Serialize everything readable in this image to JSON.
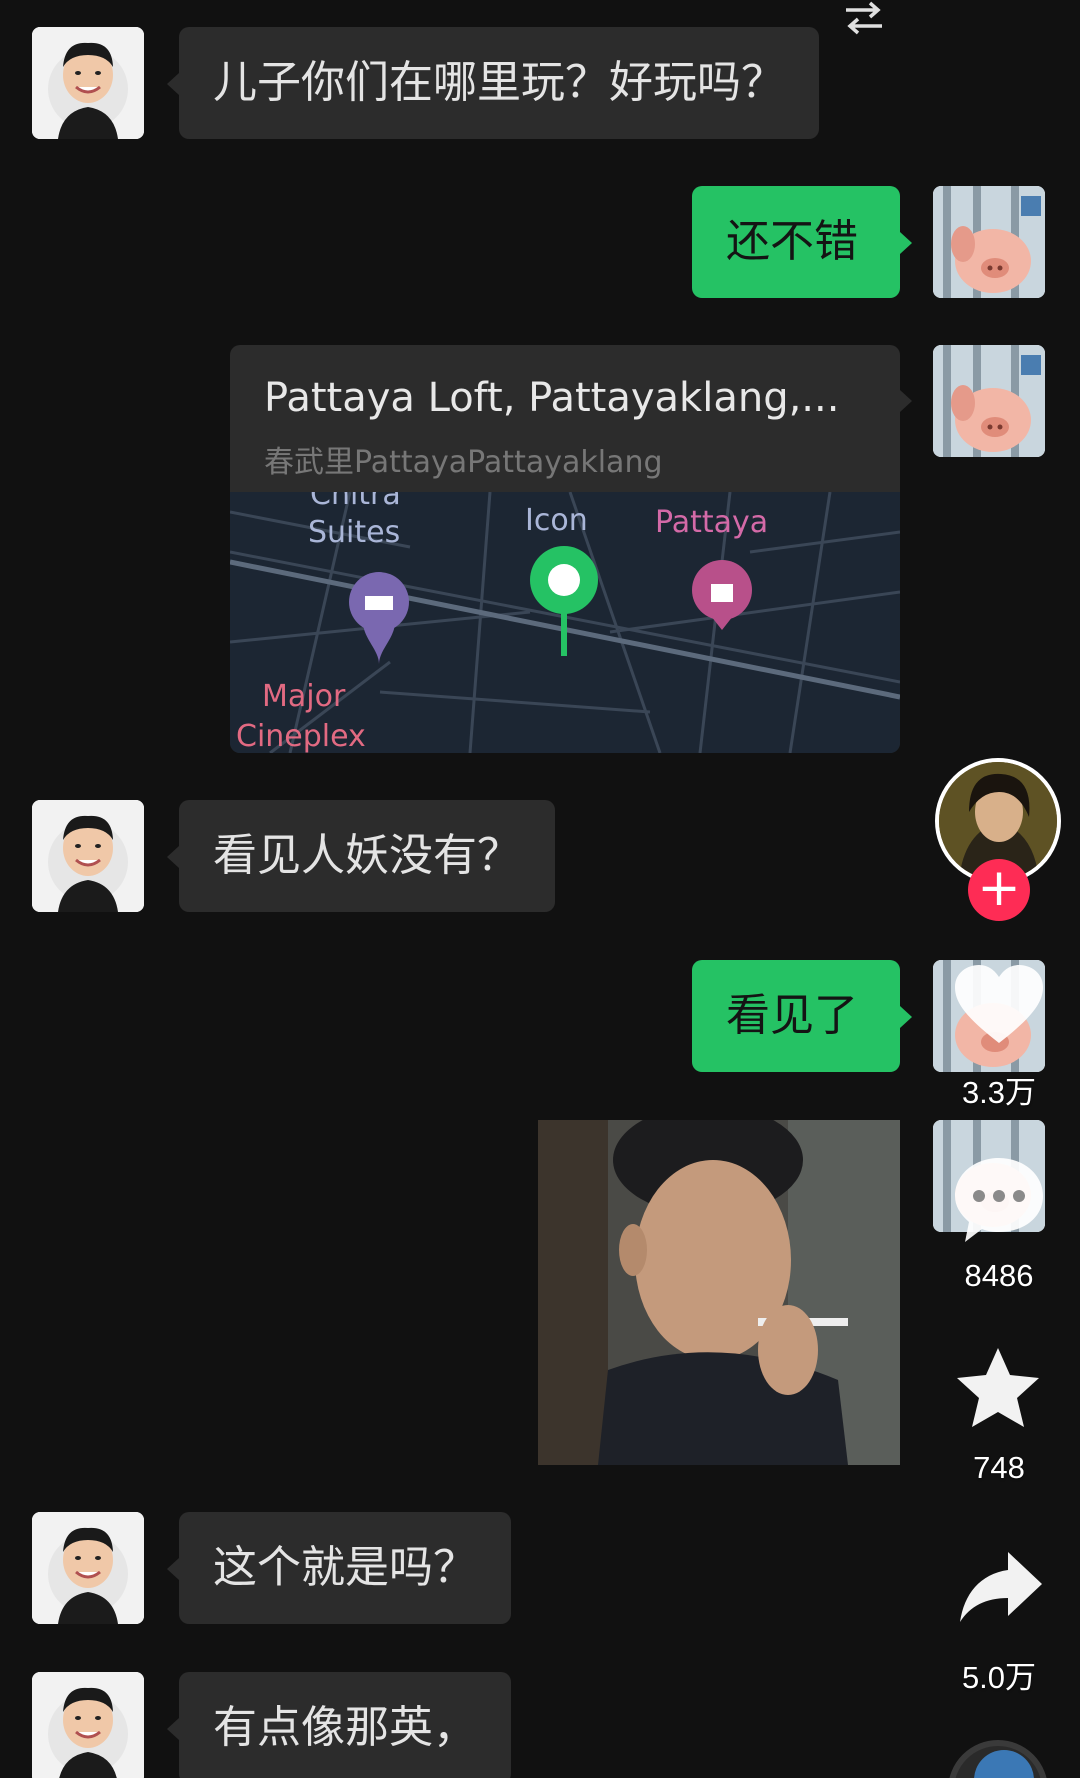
{
  "messages": [
    {
      "side": "left",
      "text": "儿子你们在哪里玩？好玩吗？"
    },
    {
      "side": "right",
      "text": "还不错"
    },
    {
      "side": "right",
      "type": "location"
    },
    {
      "side": "left",
      "text": "看见人妖没有？"
    },
    {
      "side": "right",
      "text": "看见了"
    },
    {
      "side": "right",
      "type": "image"
    },
    {
      "side": "left",
      "text": "这个就是吗？"
    },
    {
      "side": "left",
      "text": "有点像那英，"
    }
  ],
  "location": {
    "title": "Pattaya Loft, Pattayaklang,...",
    "subtitle": "春武里PattayaPattayaklang",
    "map_labels": {
      "hotel": "Chitra",
      "hotel2": "Suites",
      "poi": "Icon",
      "mall": "Pattaya",
      "cinema1": "Major",
      "cinema2": "Cineplex"
    }
  },
  "sidebar": {
    "like_count": "3.3万",
    "comment_count": "8486",
    "favorite_count": "748",
    "share_count": "5.0万"
  },
  "icons": {
    "top_right": "swap-arrows-icon",
    "follow": "plus-icon",
    "like": "heart-icon",
    "comment": "comment-icon",
    "favorite": "star-icon",
    "share": "share-arrow-icon"
  },
  "colors": {
    "background": "#111111",
    "incoming_bubble": "#2c2c2c",
    "outgoing_bubble": "#25c264",
    "follow_button": "#fe2c55"
  }
}
